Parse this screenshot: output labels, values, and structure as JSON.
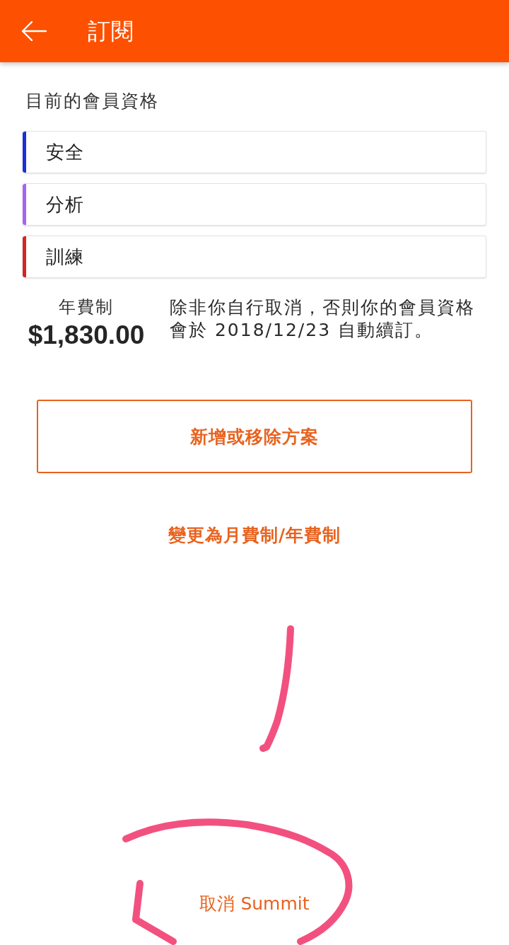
{
  "header": {
    "title": "訂閱"
  },
  "membership": {
    "heading": "目前的會員資格",
    "plans": [
      {
        "name": "安全",
        "color": "#1a30d8"
      },
      {
        "name": "分析",
        "color": "#a663f2"
      },
      {
        "name": "訓練",
        "color": "#d42424"
      }
    ]
  },
  "billing": {
    "period": "年費制",
    "price": "$1,830.00",
    "note": "除非你自行取消，否則你的會員資格會於 2018/12/23 自動續訂。"
  },
  "actions": {
    "manage_button": "新增或移除方案",
    "switch_link": "變更為月費制/年費制",
    "cancel_link": "取消 Summit"
  }
}
